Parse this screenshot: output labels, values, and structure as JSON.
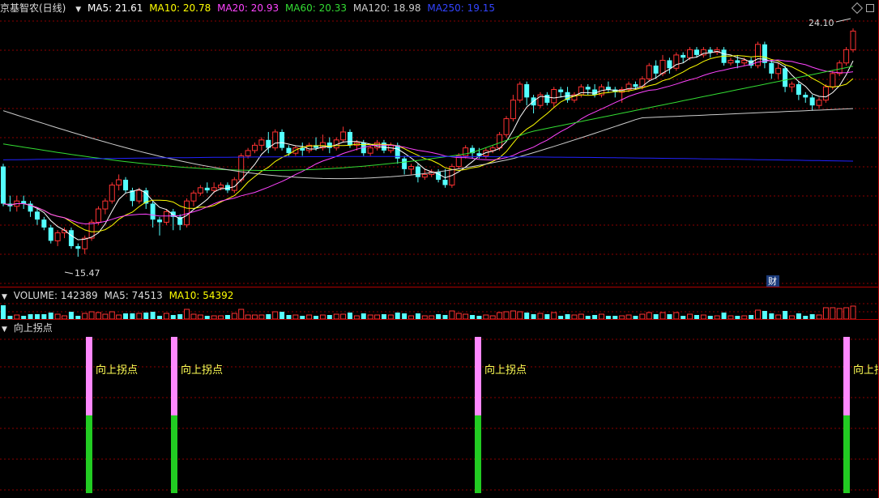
{
  "main_header": {
    "title": "京基智农(日线)",
    "ma5": "MA5: 21.61",
    "ma10": "MA10: 20.78",
    "ma20": "MA20: 20.93",
    "ma60": "MA60: 20.33",
    "ma120": "MA120: 18.98",
    "ma250": "MA250: 19.15"
  },
  "volume_header": {
    "volume": "VOLUME: 142389",
    "ma5": "MA5: 74513",
    "ma10": "MA10: 54392"
  },
  "indicator_header": {
    "title": "向上拐点"
  },
  "annotations": {
    "high": "24.10",
    "low": "15.47",
    "event_marker": "财"
  },
  "signal_label": "向上拐点",
  "colors": {
    "up": "#ff3232",
    "down": "#54ffff",
    "ma5": "#ffffff",
    "ma10": "#ffff00",
    "ma20": "#ff44ff",
    "ma60": "#33dd33",
    "ma120": "#cccccc",
    "ma250": "#2222ff",
    "grid": "#8b0000",
    "signal_top": "#ff88ff",
    "signal_bottom": "#22cc22"
  },
  "chart_data": {
    "type": "candlestick",
    "price_range": [
      14.8,
      24.5
    ],
    "candles": [
      [
        18.9,
        17.5,
        19.0,
        17.4
      ],
      [
        17.5,
        17.4,
        17.8,
        17.2
      ],
      [
        17.4,
        17.6,
        17.8,
        17.2
      ],
      [
        17.6,
        17.5,
        17.8,
        17.3
      ],
      [
        17.5,
        17.2,
        17.6,
        17.0
      ],
      [
        17.2,
        16.9,
        17.3,
        16.7
      ],
      [
        16.9,
        16.6,
        17.0,
        16.5
      ],
      [
        16.6,
        16.1,
        16.7,
        16.0
      ],
      [
        16.1,
        16.4,
        16.5,
        15.9
      ],
      [
        16.4,
        16.5,
        16.6,
        16.2
      ],
      [
        16.5,
        15.9,
        16.6,
        15.8
      ],
      [
        15.9,
        15.8,
        16.0,
        15.5
      ],
      [
        15.8,
        16.2,
        16.3,
        15.6
      ],
      [
        16.2,
        16.8,
        16.9,
        16.1
      ],
      [
        16.8,
        17.3,
        17.4,
        16.7
      ],
      [
        17.3,
        17.6,
        17.7,
        17.1
      ],
      [
        17.6,
        18.2,
        18.3,
        17.5
      ],
      [
        18.2,
        18.4,
        18.6,
        18.0
      ],
      [
        18.4,
        18.0,
        18.5,
        17.9
      ],
      [
        18.0,
        17.6,
        18.1,
        17.4
      ],
      [
        17.6,
        18.0,
        18.1,
        17.5
      ],
      [
        18.0,
        17.5,
        18.1,
        17.3
      ],
      [
        17.5,
        16.9,
        17.6,
        16.6
      ],
      [
        16.9,
        16.8,
        17.0,
        16.3
      ],
      [
        16.8,
        17.2,
        17.3,
        16.7
      ],
      [
        17.2,
        17.0,
        17.3,
        16.5
      ],
      [
        17.0,
        16.7,
        17.1,
        16.5
      ],
      [
        16.7,
        17.6,
        17.7,
        16.6
      ],
      [
        17.6,
        17.9,
        18.0,
        17.4
      ],
      [
        17.9,
        18.1,
        18.2,
        17.8
      ],
      [
        18.1,
        18.0,
        18.3,
        17.9
      ],
      [
        18.0,
        18.1,
        18.3,
        17.9
      ],
      [
        18.1,
        18.2,
        18.3,
        18.0
      ],
      [
        18.2,
        18.0,
        18.3,
        17.9
      ],
      [
        18.0,
        18.4,
        18.5,
        17.9
      ],
      [
        18.4,
        19.3,
        19.4,
        18.3
      ],
      [
        19.3,
        19.5,
        19.6,
        19.2
      ],
      [
        19.5,
        19.7,
        19.8,
        19.4
      ],
      [
        19.7,
        19.9,
        20.0,
        19.5
      ],
      [
        19.9,
        19.6,
        20.2,
        19.4
      ],
      [
        19.6,
        20.2,
        20.3,
        19.5
      ],
      [
        20.2,
        19.6,
        20.3,
        19.5
      ],
      [
        19.6,
        19.4,
        19.7,
        19.3
      ],
      [
        19.4,
        19.6,
        19.7,
        19.3
      ],
      [
        19.6,
        19.5,
        19.8,
        19.3
      ],
      [
        19.5,
        19.7,
        19.8,
        19.4
      ],
      [
        19.7,
        19.6,
        20.0,
        19.5
      ],
      [
        19.6,
        19.8,
        20.1,
        19.5
      ],
      [
        19.8,
        19.6,
        20.0,
        19.4
      ],
      [
        19.6,
        19.9,
        20.0,
        19.5
      ],
      [
        19.9,
        20.2,
        20.4,
        19.8
      ],
      [
        20.2,
        19.7,
        20.3,
        19.6
      ],
      [
        19.7,
        19.8,
        19.9,
        19.5
      ],
      [
        19.8,
        19.4,
        19.9,
        19.3
      ],
      [
        19.4,
        19.6,
        19.7,
        19.3
      ],
      [
        19.6,
        19.8,
        19.9,
        19.5
      ],
      [
        19.8,
        19.5,
        19.9,
        19.4
      ],
      [
        19.5,
        19.7,
        19.8,
        19.4
      ],
      [
        19.7,
        19.2,
        19.8,
        19.0
      ],
      [
        19.2,
        18.8,
        19.3,
        18.6
      ],
      [
        18.8,
        18.9,
        19.0,
        18.6
      ],
      [
        18.9,
        18.5,
        19.0,
        18.3
      ],
      [
        18.5,
        18.6,
        18.8,
        18.4
      ],
      [
        18.6,
        18.7,
        18.8,
        18.5
      ],
      [
        18.7,
        18.4,
        18.8,
        18.3
      ],
      [
        18.4,
        18.2,
        18.8,
        18.1
      ],
      [
        18.2,
        18.9,
        19.0,
        18.1
      ],
      [
        18.9,
        19.3,
        19.4,
        18.8
      ],
      [
        19.3,
        19.6,
        19.7,
        19.2
      ],
      [
        19.6,
        19.4,
        19.7,
        19.2
      ],
      [
        19.4,
        19.3,
        19.6,
        19.2
      ],
      [
        19.3,
        19.5,
        19.6,
        19.2
      ],
      [
        19.5,
        19.6,
        19.7,
        19.4
      ],
      [
        19.6,
        20.1,
        20.2,
        19.5
      ],
      [
        20.1,
        20.7,
        20.8,
        20.0
      ],
      [
        20.7,
        21.4,
        21.6,
        20.6
      ],
      [
        21.4,
        22.0,
        22.1,
        21.3
      ],
      [
        22.0,
        21.5,
        22.1,
        21.2
      ],
      [
        21.5,
        21.2,
        21.6,
        20.9
      ],
      [
        21.2,
        21.6,
        21.7,
        21.1
      ],
      [
        21.6,
        21.3,
        21.7,
        21.2
      ],
      [
        21.3,
        21.8,
        21.9,
        21.1
      ],
      [
        21.8,
        21.7,
        21.9,
        21.5
      ],
      [
        21.7,
        21.4,
        21.9,
        21.3
      ],
      [
        21.4,
        21.6,
        21.7,
        21.3
      ],
      [
        21.6,
        21.9,
        22.0,
        21.5
      ],
      [
        21.9,
        21.8,
        22.0,
        21.6
      ],
      [
        21.8,
        21.6,
        22.0,
        21.5
      ],
      [
        21.6,
        21.9,
        22.0,
        21.5
      ],
      [
        21.9,
        21.8,
        22.1,
        21.7
      ],
      [
        21.8,
        21.7,
        21.9,
        21.5
      ],
      [
        21.7,
        21.8,
        21.9,
        21.3
      ],
      [
        21.8,
        22.0,
        22.1,
        21.7
      ],
      [
        22.0,
        21.9,
        22.1,
        21.8
      ],
      [
        21.9,
        22.2,
        22.3,
        21.8
      ],
      [
        22.2,
        22.7,
        22.8,
        22.1
      ],
      [
        22.7,
        22.4,
        22.9,
        22.2
      ],
      [
        22.4,
        22.9,
        23.1,
        22.3
      ],
      [
        22.9,
        22.6,
        23.0,
        22.4
      ],
      [
        22.6,
        23.1,
        23.2,
        22.5
      ],
      [
        23.1,
        23.0,
        23.2,
        22.8
      ],
      [
        23.0,
        23.3,
        23.4,
        22.9
      ],
      [
        23.3,
        23.1,
        23.4,
        23.0
      ],
      [
        23.1,
        23.3,
        23.4,
        23.0
      ],
      [
        23.3,
        23.2,
        23.4,
        23.0
      ],
      [
        23.2,
        23.3,
        23.4,
        23.1
      ],
      [
        23.3,
        22.8,
        23.4,
        22.7
      ],
      [
        22.8,
        22.9,
        23.0,
        22.7
      ],
      [
        22.9,
        22.8,
        23.1,
        22.6
      ],
      [
        22.8,
        22.9,
        23.0,
        22.7
      ],
      [
        22.9,
        22.7,
        23.0,
        22.6
      ],
      [
        22.7,
        23.5,
        23.6,
        22.6
      ],
      [
        23.5,
        22.8,
        23.6,
        22.6
      ],
      [
        22.8,
        22.4,
        22.9,
        22.2
      ],
      [
        22.4,
        22.6,
        22.8,
        22.2
      ],
      [
        22.6,
        21.9,
        22.7,
        21.7
      ],
      [
        21.9,
        22.0,
        22.1,
        21.7
      ],
      [
        22.0,
        21.6,
        22.1,
        21.4
      ],
      [
        21.6,
        21.5,
        21.7,
        21.3
      ],
      [
        21.5,
        21.2,
        21.6,
        21.0
      ],
      [
        21.2,
        21.4,
        21.5,
        21.1
      ],
      [
        21.4,
        21.9,
        22.0,
        21.3
      ],
      [
        21.9,
        22.4,
        22.5,
        21.8
      ],
      [
        22.4,
        22.8,
        22.9,
        22.3
      ],
      [
        22.8,
        23.3,
        23.4,
        22.7
      ],
      [
        23.3,
        24.0,
        24.1,
        23.2
      ]
    ],
    "indicator_signals": {
      "label": "向上拐点",
      "bar_x": [
        110,
        215,
        590,
        1045
      ]
    }
  }
}
